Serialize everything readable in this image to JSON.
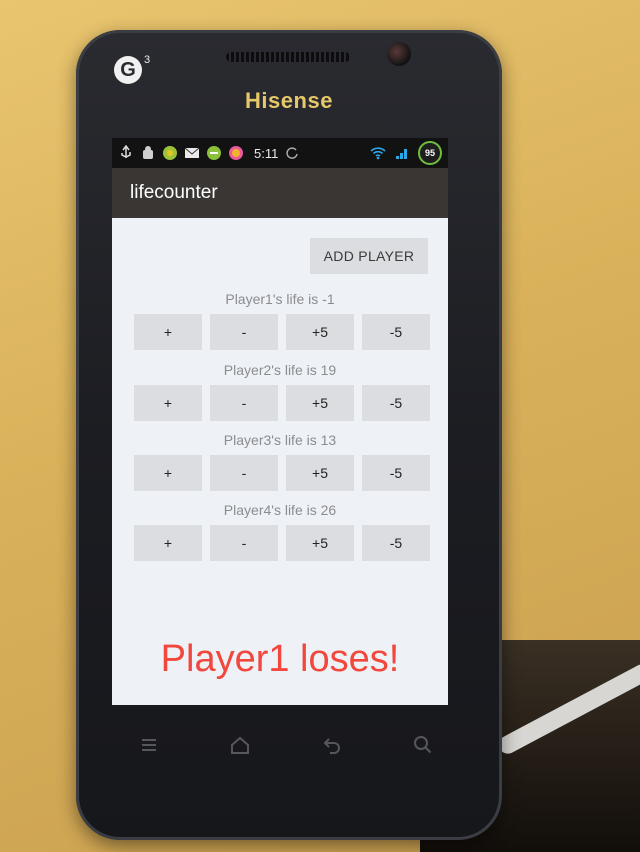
{
  "device": {
    "brand": "Hisense",
    "logo_text": "G",
    "logo_sup": "3"
  },
  "statusbar": {
    "time": "5:11",
    "battery_level": "95",
    "icons": [
      "usb-icon",
      "android-debug-icon",
      "app-notification-icon",
      "mail-icon",
      "app-notification-icon",
      "app-notification-icon",
      "sync-icon",
      "wifi-icon",
      "signal-icon",
      "battery-icon"
    ]
  },
  "app": {
    "title": "lifecounter",
    "add_player_label": "ADD PLAYER",
    "players": [
      {
        "label": "Player1's life is -1",
        "buttons": [
          "+",
          "-",
          "+5",
          "-5"
        ]
      },
      {
        "label": "Player2's life is 19",
        "buttons": [
          "+",
          "-",
          "+5",
          "-5"
        ]
      },
      {
        "label": "Player3's life is 13",
        "buttons": [
          "+",
          "-",
          "+5",
          "-5"
        ]
      },
      {
        "label": "Player4's life is 26",
        "buttons": [
          "+",
          "-",
          "+5",
          "-5"
        ]
      }
    ],
    "lose_message": "Player1 loses!",
    "lose_color": "#f2473c"
  },
  "navbar": {
    "icons": [
      "menu-icon",
      "home-icon",
      "back-icon",
      "search-icon"
    ]
  }
}
